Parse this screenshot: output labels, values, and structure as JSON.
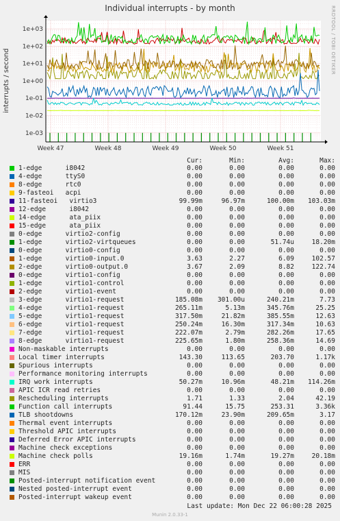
{
  "title": "Individual interrupts - by month",
  "side_label": "RRDTOOL / TOBI OETIKER",
  "ylabel": "interrupts / second",
  "header": {
    "cur": "Cur:",
    "min": "Min:",
    "avg": "Avg:",
    "max": "Max:"
  },
  "last_update": "Last update:  Mon Dec 22 06:00:28 2025",
  "version": "Munin 2.0.33-1",
  "chart_data": {
    "type": "line",
    "title": "Individual interrupts - by month",
    "ylabel": "interrupts / second",
    "yscale": "log",
    "ylim": [
      0.0003,
      3000
    ],
    "y_ticks": [
      "1e-03",
      "1e-02",
      "1e-01",
      "1e+00",
      "1e+01",
      "1e+02",
      "1e+03"
    ],
    "x_ticks": [
      "Week 47",
      "Week 48",
      "Week 49",
      "Week 50",
      "Week 51"
    ],
    "grid": true,
    "series": [
      {
        "name": "Local timer interrupts",
        "color": "#cc0000",
        "cur": 143.3,
        "min": 113.65,
        "avg": 203.7,
        "max": 1170
      },
      {
        "name": "Function call interrupts",
        "color": "#00cc00",
        "cur": 91.44,
        "min": 15.75,
        "avg": 253.31,
        "max": 3360
      },
      {
        "name": "Rescheduling interrupts",
        "color": "#999900",
        "cur": 1.71,
        "min": 1.33,
        "avg": 2.04,
        "max": 42.19
      },
      {
        "name": "virtio0-input.0",
        "color": "#cc9900",
        "cur": 3.63,
        "min": 2.27,
        "avg": 6.09,
        "max": 102.57
      },
      {
        "name": "virtio0-output.0",
        "color": "#996600",
        "cur": 3.67,
        "min": 2.09,
        "avg": 8.82,
        "max": 122.74
      },
      {
        "name": "virtio3",
        "color": "#660099",
        "cur": 0.09999,
        "min": 0.09697,
        "avg": 0.1,
        "max": 0.10303
      },
      {
        "name": "virtio1-request",
        "color": "#0066b3",
        "cur": 0.185,
        "min": 0.0003,
        "avg": 0.24,
        "max": 7.73
      },
      {
        "name": "IRQ work interrupts",
        "color": "#00cccc",
        "cur": 0.0503,
        "min": 0.011,
        "avg": 0.0482,
        "max": 0.114
      },
      {
        "name": "Machine check polls",
        "color": "#ccff00",
        "cur": 0.0192,
        "min": 0.0017,
        "avg": 0.0193,
        "max": 0.0202
      }
    ]
  },
  "rows": [
    {
      "name": "1-edge      i8042",
      "color": "#00cc00",
      "cur": "0.00",
      "min": "0.00",
      "avg": "0.00",
      "max": "0.00"
    },
    {
      "name": "4-edge      ttyS0",
      "color": "#0066b3",
      "cur": "0.00",
      "min": "0.00",
      "avg": "0.00",
      "max": "0.00"
    },
    {
      "name": "8-edge      rtc0",
      "color": "#ff8000",
      "cur": "0.00",
      "min": "0.00",
      "avg": "0.00",
      "max": "0.00"
    },
    {
      "name": "9-fasteoi   acpi",
      "color": "#ffcc00",
      "cur": "0.00",
      "min": "0.00",
      "avg": "0.00",
      "max": "0.00"
    },
    {
      "name": "11-fasteoi   virtio3",
      "color": "#330099",
      "cur": "99.99m",
      "min": "96.97m",
      "avg": "100.00m",
      "max": "103.03m"
    },
    {
      "name": "12-edge      i8042",
      "color": "#990099",
      "cur": "0.00",
      "min": "0.00",
      "avg": "0.00",
      "max": "0.00"
    },
    {
      "name": "14-edge      ata_piix",
      "color": "#ccff00",
      "cur": "0.00",
      "min": "0.00",
      "avg": "0.00",
      "max": "0.00"
    },
    {
      "name": "15-edge      ata_piix",
      "color": "#ff0000",
      "cur": "0.00",
      "min": "0.00",
      "avg": "0.00",
      "max": "0.00"
    },
    {
      "name": "0-edge      virtio2-config",
      "color": "#808080",
      "cur": "0.00",
      "min": "0.00",
      "avg": "0.00",
      "max": "0.00"
    },
    {
      "name": "1-edge      virtio2-virtqueues",
      "color": "#008f00",
      "cur": "0.00",
      "min": "0.00",
      "avg": "51.74u",
      "max": "18.20m"
    },
    {
      "name": "0-edge      virtio0-config",
      "color": "#00487d",
      "cur": "0.00",
      "min": "0.00",
      "avg": "0.00",
      "max": "0.00"
    },
    {
      "name": "1-edge      virtio0-input.0",
      "color": "#b35a00",
      "cur": "3.63",
      "min": "2.27",
      "avg": "6.09",
      "max": "102.57"
    },
    {
      "name": "2-edge      virtio0-output.0",
      "color": "#b38f00",
      "cur": "3.67",
      "min": "2.09",
      "avg": "8.82",
      "max": "122.74"
    },
    {
      "name": "0-edge      virtio1-config",
      "color": "#6b006b",
      "cur": "0.00",
      "min": "0.00",
      "avg": "0.00",
      "max": "0.00"
    },
    {
      "name": "1-edge      virtio1-control",
      "color": "#8fb300",
      "cur": "0.00",
      "min": "0.00",
      "avg": "0.00",
      "max": "0.00"
    },
    {
      "name": "2-edge      virtio1-event",
      "color": "#b30000",
      "cur": "0.00",
      "min": "0.00",
      "avg": "0.00",
      "max": "0.00"
    },
    {
      "name": "3-edge      virtio1-request",
      "color": "#bebebe",
      "cur": "185.08m",
      "min": "301.00u",
      "avg": "240.21m",
      "max": "7.73"
    },
    {
      "name": "4-edge      virtio1-request",
      "color": "#80ff80",
      "cur": "265.11m",
      "min": "5.13m",
      "avg": "345.76m",
      "max": "25.25"
    },
    {
      "name": "5-edge      virtio1-request",
      "color": "#80c9ff",
      "cur": "317.50m",
      "min": "21.82m",
      "avg": "385.55m",
      "max": "12.63"
    },
    {
      "name": "6-edge      virtio1-request",
      "color": "#ffc080",
      "cur": "250.24m",
      "min": "16.30m",
      "avg": "317.34m",
      "max": "10.63"
    },
    {
      "name": "7-edge      virtio1-request",
      "color": "#ffe680",
      "cur": "222.07m",
      "min": "2.79m",
      "avg": "282.26m",
      "max": "17.65"
    },
    {
      "name": "8-edge      virtio1-request",
      "color": "#aa80ff",
      "cur": "225.65m",
      "min": "1.80m",
      "avg": "258.36m",
      "max": "14.69"
    },
    {
      "name": "Non-maskable interrupts",
      "color": "#ee00cc",
      "cur": "0.00",
      "min": "0.00",
      "avg": "0.00",
      "max": "0.00"
    },
    {
      "name": "Local timer interrupts",
      "color": "#ff8080",
      "cur": "143.30",
      "min": "113.65",
      "avg": "203.70",
      "max": "1.17k"
    },
    {
      "name": "Spurious interrupts",
      "color": "#666600",
      "cur": "0.00",
      "min": "0.00",
      "avg": "0.00",
      "max": "0.00"
    },
    {
      "name": "Performance monitoring interrupts",
      "color": "#ffbfff",
      "cur": "0.00",
      "min": "0.00",
      "avg": "0.00",
      "max": "0.00"
    },
    {
      "name": "IRQ work interrupts",
      "color": "#00ffcc",
      "cur": "50.27m",
      "min": "10.96m",
      "avg": "48.21m",
      "max": "114.26m"
    },
    {
      "name": "APIC ICR read retries",
      "color": "#cc6699",
      "cur": "0.00",
      "min": "0.00",
      "avg": "0.00",
      "max": "0.00"
    },
    {
      "name": "Rescheduling interrupts",
      "color": "#999900",
      "cur": "1.71",
      "min": "1.33",
      "avg": "2.04",
      "max": "42.19"
    },
    {
      "name": "Function call interrupts",
      "color": "#00cc00",
      "cur": "91.44",
      "min": "15.75",
      "avg": "253.31",
      "max": "3.36k"
    },
    {
      "name": "TLB shootdowns",
      "color": "#0066b3",
      "cur": "170.12m",
      "min": "23.90m",
      "avg": "209.65m",
      "max": "3.17"
    },
    {
      "name": "Thermal event interrupts",
      "color": "#ff8000",
      "cur": "0.00",
      "min": "0.00",
      "avg": "0.00",
      "max": "0.00"
    },
    {
      "name": "Threshold APIC interrupts",
      "color": "#ffcc00",
      "cur": "0.00",
      "min": "0.00",
      "avg": "0.00",
      "max": "0.00"
    },
    {
      "name": "Deferred Error APIC interrupts",
      "color": "#330099",
      "cur": "0.00",
      "min": "0.00",
      "avg": "0.00",
      "max": "0.00"
    },
    {
      "name": "Machine check exceptions",
      "color": "#990099",
      "cur": "0.00",
      "min": "0.00",
      "avg": "0.00",
      "max": "0.00"
    },
    {
      "name": "Machine check polls",
      "color": "#ccff00",
      "cur": "19.16m",
      "min": "1.74m",
      "avg": "19.27m",
      "max": "20.18m"
    },
    {
      "name": "ERR",
      "color": "#ff0000",
      "cur": "0.00",
      "min": "0.00",
      "avg": "0.00",
      "max": "0.00"
    },
    {
      "name": "MIS",
      "color": "#808080",
      "cur": "0.00",
      "min": "0.00",
      "avg": "0.00",
      "max": "0.00"
    },
    {
      "name": "Posted-interrupt notification event",
      "color": "#008f00",
      "cur": "0.00",
      "min": "0.00",
      "avg": "0.00",
      "max": "0.00"
    },
    {
      "name": "Nested posted-interrupt event",
      "color": "#00487d",
      "cur": "0.00",
      "min": "0.00",
      "avg": "0.00",
      "max": "0.00"
    },
    {
      "name": "Posted-interrupt wakeup event",
      "color": "#b35a00",
      "cur": "0.00",
      "min": "0.00",
      "avg": "0.00",
      "max": "0.00"
    }
  ]
}
